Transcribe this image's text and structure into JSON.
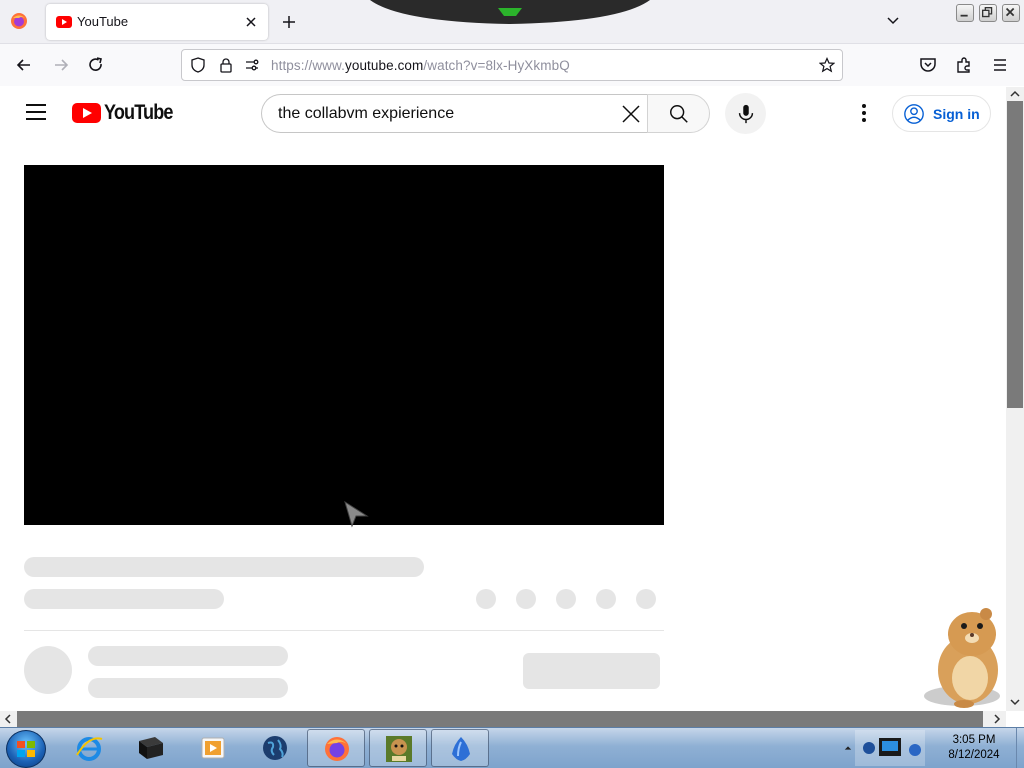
{
  "browser": {
    "tab": {
      "title": "YouTube"
    },
    "url": {
      "prefix": "https://www.",
      "host": "youtube.com",
      "path": "/watch?v=8lx-HyXkmbQ"
    }
  },
  "youtube": {
    "logo_text": "YouTube",
    "search": {
      "value": "the collabvm expierience"
    },
    "signin_label": "Sign in"
  },
  "taskbar": {
    "apps": [
      {
        "name": "internet-explorer-icon"
      },
      {
        "name": "terminal-icon"
      },
      {
        "name": "media-player-icon"
      },
      {
        "name": "globe-icon"
      },
      {
        "name": "firefox-icon",
        "active": true
      },
      {
        "name": "bonzi-box-icon",
        "active": true
      },
      {
        "name": "bluebird-icon",
        "active": true
      }
    ],
    "clock": {
      "time": "3:05 PM",
      "date": "8/12/2024"
    }
  },
  "colors": {
    "youtube_red": "#ff0000",
    "signin_blue": "#065fd4",
    "taskbar": "#8fb0d4"
  }
}
